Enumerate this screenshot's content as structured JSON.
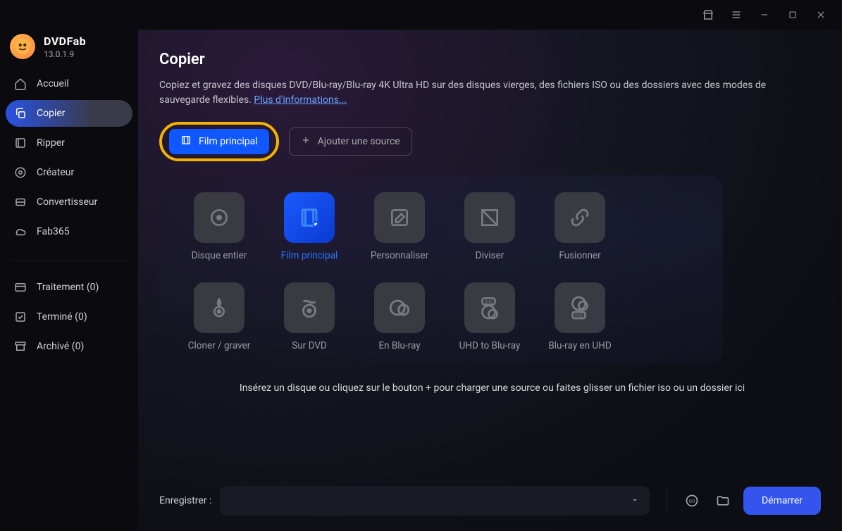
{
  "brand": {
    "name": "DVDFab",
    "version": "13.0.1.9"
  },
  "sidebar": {
    "items": [
      {
        "label": "Accueil"
      },
      {
        "label": "Copier"
      },
      {
        "label": "Ripper"
      },
      {
        "label": "Créateur"
      },
      {
        "label": "Convertisseur"
      },
      {
        "label": "Fab365"
      }
    ],
    "status": [
      {
        "label": "Traitement (0)"
      },
      {
        "label": "Terminé (0)"
      },
      {
        "label": "Archivé (0)"
      }
    ]
  },
  "page": {
    "title": "Copier",
    "description_part1": "Copiez et gravez des disques DVD/Blu-ray/Blu-ray 4K Ultra HD sur des disques vierges, des fichiers ISO ou des dossiers avec des modes de sauvegarde flexibles. ",
    "more_link": "Plus d'informations..."
  },
  "buttons": {
    "film_principal": "Film principal",
    "add_source": "Ajouter une source",
    "start": "Démarrer"
  },
  "modes": [
    {
      "label": "Disque entier"
    },
    {
      "label": "Film principal"
    },
    {
      "label": "Personnaliser"
    },
    {
      "label": "Diviser"
    },
    {
      "label": "Fusionner"
    },
    {
      "label": "Cloner / graver"
    },
    {
      "label": "Sur DVD"
    },
    {
      "label": "En Blu-ray"
    },
    {
      "label": "UHD to Blu-ray"
    },
    {
      "label": "Blu-ray en UHD"
    }
  ],
  "dropzone_hint": "Insérez un disque ou cliquez sur le bouton + pour charger une source ou faites glisser un fichier iso ou un dossier ici",
  "footer": {
    "save_label": "Enregistrer :"
  }
}
